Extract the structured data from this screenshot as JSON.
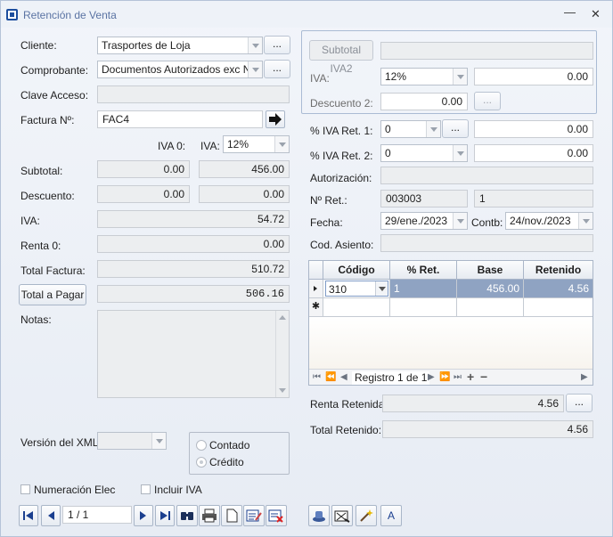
{
  "window": {
    "title": "Retención de Venta"
  },
  "left": {
    "cliente_label": "Cliente:",
    "cliente_value": "Trasportes de Loja",
    "comprobante_label": "Comprobante:",
    "comprobante_value": "Documentos Autorizados exc N...",
    "clave_label": "Clave Acceso:",
    "clave_value": "",
    "factura_label": "Factura Nº:",
    "factura_value": "FAC4",
    "iva0_label": "IVA 0:",
    "iva_label": "IVA:",
    "iva_rate": "12%",
    "subtotal_label": "Subtotal:",
    "subtotal_0": "0.00",
    "subtotal_iva": "456.00",
    "descuento_label": "Descuento:",
    "descuento_0": "0.00",
    "descuento_iva": "0.00",
    "iva_row_label": "IVA:",
    "iva_value": "54.72",
    "renta0_label": "Renta 0:",
    "renta0_value": "0.00",
    "total_factura_label": "Total Factura:",
    "total_factura_value": "510.72",
    "total_pagar_button": "Total a Pagar",
    "total_pagar_value": "506.16",
    "notas_label": "Notas:",
    "notas_value": "",
    "version_label": "Versión del XML:",
    "version_value": "",
    "contado_label": "Contado",
    "credito_label": "Crédito",
    "numeracion_label": "Numeración Elec",
    "incluir_iva_label": "Incluir IVA",
    "record_position": "1 / 1"
  },
  "right": {
    "subtotal_iva2_button": "Subtotal IVA2",
    "subtotal_iva2_value": "",
    "iva_label": "IVA:",
    "iva_rate": "12%",
    "iva_value": "0.00",
    "descuento2_label": "Descuento 2:",
    "descuento2_value": "0.00",
    "ivaret1_label": "% IVA Ret. 1:",
    "ivaret1_value": "0",
    "ivaret1_amount": "0.00",
    "ivaret2_label": "% IVA Ret. 2:",
    "ivaret2_value": "0",
    "ivaret2_amount": "0.00",
    "autorizacion_label": "Autorización:",
    "autorizacion_value": "",
    "nret_label": "Nº Ret.:",
    "nret_value": "003003",
    "nret_seq": "1",
    "fecha_label": "Fecha:",
    "fecha_value": "29/ene./2023",
    "contb_label": "Contb:",
    "contb_value": "24/nov./2023",
    "cod_asiento_label": "Cod. Asiento:",
    "cod_asiento_value": "",
    "renta_retenida_label": "Renta Retenida:",
    "renta_retenida_value": "4.56",
    "total_retenido_label": "Total Retenido:",
    "total_retenido_value": "4.56"
  },
  "grid": {
    "columns": [
      "Código",
      "% Ret.",
      "Base",
      "Retenido"
    ],
    "rows": [
      [
        "310",
        "1",
        "456.00",
        "4.56"
      ]
    ],
    "nav_text": "Registro 1 de 1"
  },
  "common": {
    "ellipsis": "...",
    "letter_a": "A"
  },
  "colors": {
    "selected_row": "#8fa3c2",
    "group_border": "#aabbd4",
    "title_text": "#5a73a3"
  },
  "icons": [
    "first-record-icon",
    "prev-record-icon",
    "next-record-icon",
    "last-record-icon",
    "binoculars-icon",
    "print-icon",
    "new-document-icon",
    "edit-icon",
    "delete-icon",
    "save-icon",
    "sign-icon",
    "magic-wand-icon",
    "arrow-right-icon"
  ]
}
